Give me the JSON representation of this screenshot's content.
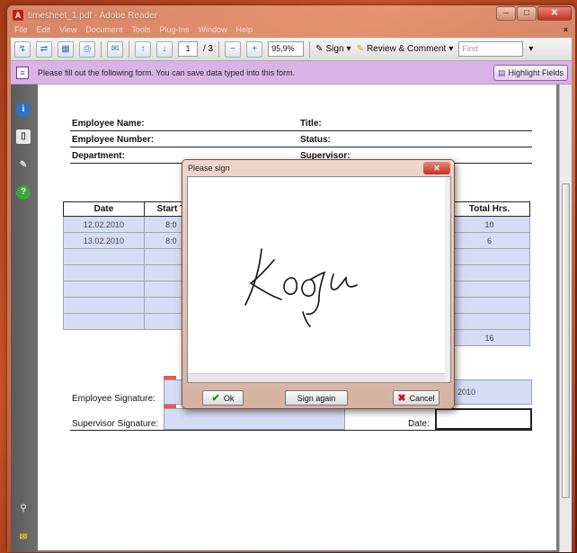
{
  "window": {
    "title": "timesheet_1.pdf - Adobe Reader"
  },
  "menu": [
    "File",
    "Edit",
    "View",
    "Document",
    "Tools",
    "Plug-Ins",
    "Window",
    "Help"
  ],
  "toolbar": {
    "page_current": "1",
    "page_total": "/ 3",
    "zoom": "95,9%",
    "sign_label": "Sign",
    "review_label": "Review & Comment",
    "find_placeholder": "Find"
  },
  "formbar": {
    "message": "Please fill out the following form. You can save data typed into this form.",
    "highlight_label": "Highlight Fields"
  },
  "form": {
    "employee_name": "Employee Name:",
    "employee_number": "Employee Number:",
    "department": "Department:",
    "title": "Title:",
    "status": "Status:",
    "supervisor": "Supervisor:",
    "columns": [
      "Date",
      "Start T",
      "Total Hrs."
    ],
    "rows": [
      {
        "date": "12.02.2010",
        "start": "8:0",
        "total": "10"
      },
      {
        "date": "13.02.2010",
        "start": "8:0",
        "total": "6"
      },
      {
        "date": "",
        "start": "",
        "total": ""
      },
      {
        "date": "",
        "start": "",
        "total": ""
      },
      {
        "date": "",
        "start": "",
        "total": ""
      },
      {
        "date": "",
        "start": "",
        "total": ""
      },
      {
        "date": "",
        "start": "",
        "total": ""
      }
    ],
    "grand_total": "16",
    "employee_signature": "Employee Signature:",
    "supervisor_signature": "Supervisor Signature:",
    "date_label": "Date:",
    "employee_date_value": "2010"
  },
  "dialog": {
    "title": "Please sign",
    "ok_label": "Ok",
    "sign_again_label": "Sign again",
    "cancel_label": "Cancel"
  }
}
